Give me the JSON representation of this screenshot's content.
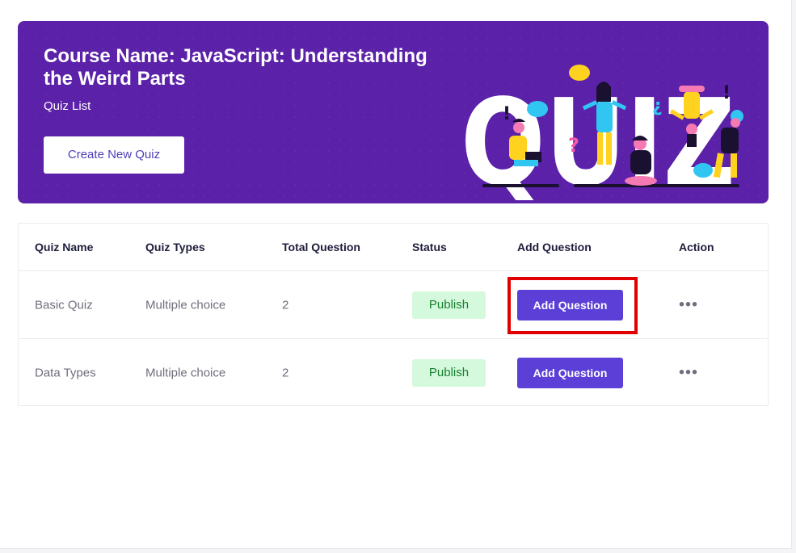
{
  "banner": {
    "title": "Course Name: JavaScript: Understanding the Weird Parts",
    "subtitle": "Quiz List",
    "create_button": "Create New Quiz",
    "illustration": "QUIZ"
  },
  "table": {
    "headers": [
      "Quiz Name",
      "Quiz Types",
      "Total Question",
      "Status",
      "Add Question",
      "Action"
    ],
    "rows": [
      {
        "name": "Basic Quiz",
        "type": "Multiple choice",
        "total": "2",
        "status": "Publish",
        "add_label": "Add Question",
        "action": "•••"
      },
      {
        "name": "Data Types",
        "type": "Multiple choice",
        "total": "2",
        "status": "Publish",
        "add_label": "Add Question",
        "action": "•••"
      }
    ]
  },
  "colors": {
    "banner": "#5b21a8",
    "button": "#5b3fd6",
    "badge_bg": "#d5f9dc",
    "highlight": "#e00000"
  }
}
